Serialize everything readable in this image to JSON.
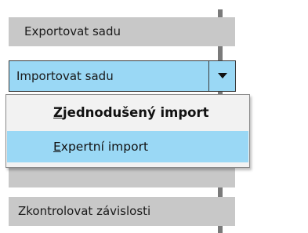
{
  "panel": {
    "export_button": {
      "label": "Exportovat sadu"
    },
    "import_split_button": {
      "label": "Importovat sadu"
    },
    "check_dependencies_button": {
      "label": "Zkontrolovat závislosti"
    }
  },
  "import_menu": {
    "items": [
      {
        "first": "Z",
        "rest": "jednodušený import",
        "bold": true,
        "highlighted": false
      },
      {
        "first": "E",
        "rest": "xpertní import",
        "bold": false,
        "highlighted": true
      }
    ]
  },
  "colors": {
    "button_bg": "#c8c8c8",
    "highlight_bg": "#9ad8f5",
    "separator": "#7a7a7a"
  }
}
